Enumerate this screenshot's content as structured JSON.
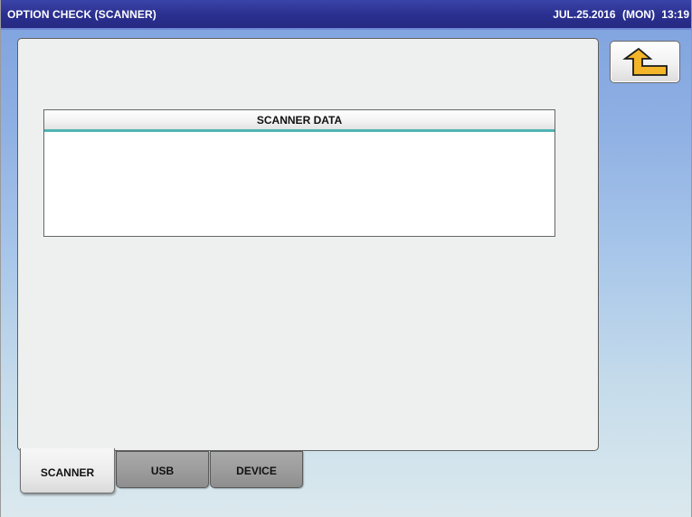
{
  "header": {
    "title": "OPTION CHECK (SCANNER)",
    "date": "JUL.25.2016",
    "weekday": "(MON)",
    "time": "13:19"
  },
  "toolbar": {
    "back_icon": "return-arrow-icon"
  },
  "scanner_data": {
    "heading": "SCANNER DATA",
    "content": ""
  },
  "tabs": [
    {
      "label": "SCANNER",
      "active": true
    },
    {
      "label": "USB",
      "active": false
    },
    {
      "label": "DEVICE",
      "active": false
    }
  ],
  "colors": {
    "titlebar": "#2a2f8f",
    "accent_line": "#4fb5b4",
    "back_icon_fill": "#f3b52a",
    "panel": "#edf0ef"
  }
}
